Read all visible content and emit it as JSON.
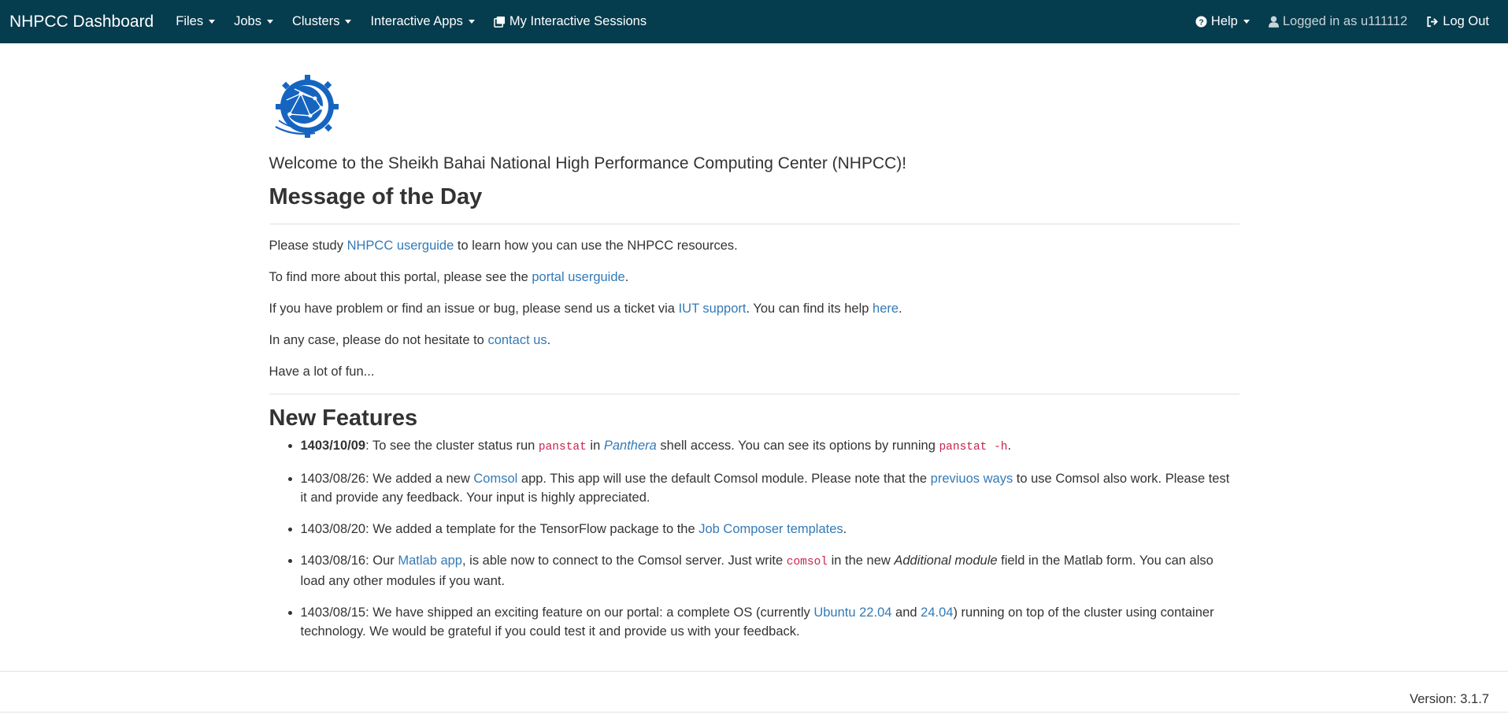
{
  "navbar": {
    "brand": "NHPCC Dashboard",
    "menus": [
      "Files",
      "Jobs",
      "Clusters",
      "Interactive Apps"
    ],
    "sessions_label": "My Interactive Sessions",
    "help_label": "Help",
    "user_label": "Logged in as u111112",
    "logout_label": "Log Out",
    "bg_color": "#053c4e"
  },
  "welcome": "Welcome to the Sheikh Bahai National High Performance Computing Center (NHPCC)!",
  "motd": {
    "title": "Message of the Day",
    "p1_a": "Please study ",
    "p1_link": "NHPCC userguide",
    "p1_b": " to learn how you can use the NHPCC resources.",
    "p2_a": "To find more about this portal, please see the ",
    "p2_link": "portal userguide",
    "p2_b": ".",
    "p3_a": "If you have problem or find an issue or bug, please send us a ticket via ",
    "p3_link1": "IUT support",
    "p3_b": ". You can find its help ",
    "p3_link2": "here",
    "p3_c": ".",
    "p4_a": "In any case, please do not hesitate to ",
    "p4_link": "contact us",
    "p4_b": ".",
    "p5": "Have a lot of fun..."
  },
  "features": {
    "title": "New Features",
    "f1": {
      "date": "1403/10/09",
      "a": ": To see the cluster status run ",
      "code1": "panstat",
      "b": " in ",
      "em": "Panthera",
      "c": " shell access. You can see its options by running ",
      "code2": "panstat -h",
      "d": "."
    },
    "f2": {
      "a": "1403/08/26: We added a new ",
      "link1": "Comsol",
      "b": " app. This app will use the default Comsol module. Please note that the ",
      "link2": "previuos ways",
      "c": " to use Comsol also work. Please test it and provide any feedback. Your input is highly appreciated."
    },
    "f3": {
      "a": "1403/08/20: We added a template for the TensorFlow package to the ",
      "link": "Job Composer templates",
      "b": "."
    },
    "f4": {
      "a": "1403/08/16: Our ",
      "link": "Matlab app",
      "b": ", is able now to connect to the Comsol server. Just write ",
      "code": "comsol",
      "c": " in the new ",
      "em": "Additional module",
      "d": " field in the Matlab form. You can also load any other modules if you want."
    },
    "f5": {
      "a": "1403/08/15: We have shipped an exciting feature on our portal: a complete OS (currently ",
      "link1": "Ubuntu 22.04",
      "b": " and ",
      "link2": "24.04",
      "c": ") running on top of the cluster using container technology. We would be grateful if you could test it and provide us with your feedback."
    }
  },
  "footer": {
    "version": "Version: 3.1.7"
  },
  "colors": {
    "link": "#337ab7",
    "code": "#c7254e",
    "logo": "#1565c0"
  }
}
